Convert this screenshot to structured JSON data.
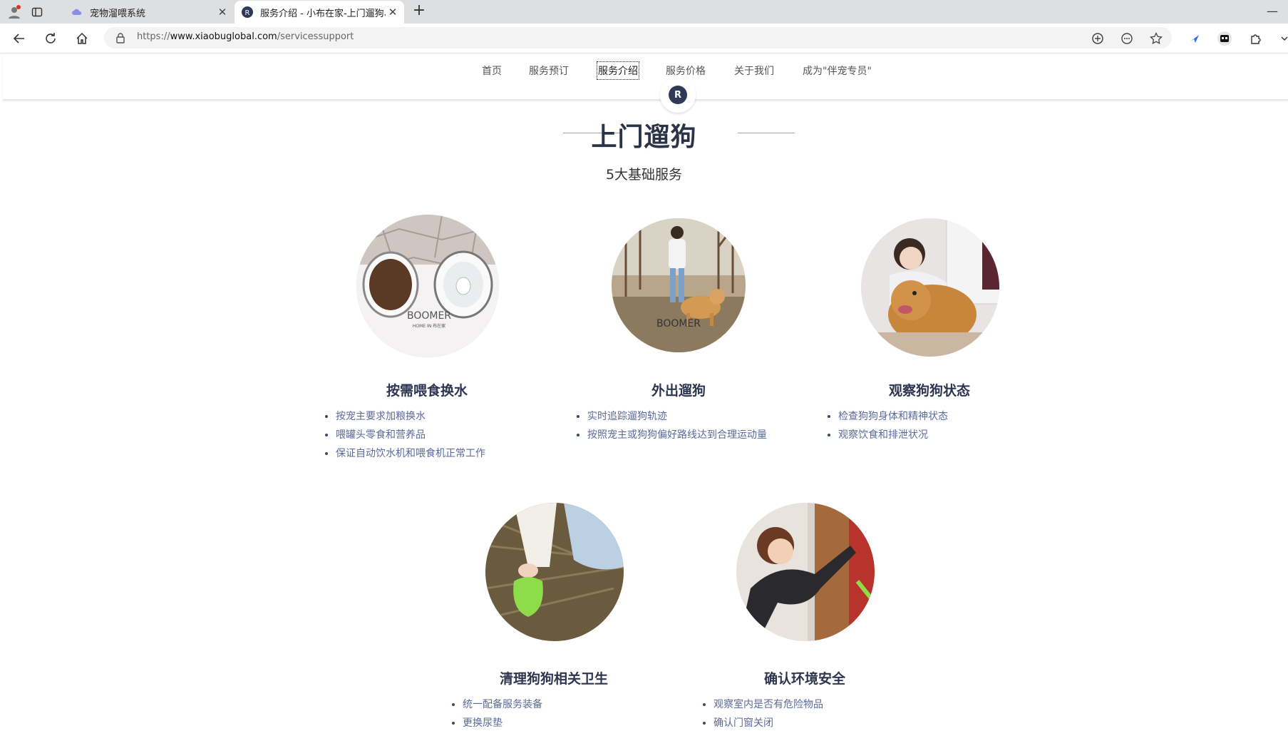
{
  "browser": {
    "tabs": [
      {
        "title": "宠物溜喂系统",
        "active": false
      },
      {
        "title": "服务介绍 - 小布在家-上门遛狗、上",
        "active": true
      }
    ],
    "url_prefix": "https://",
    "url_host": "www.xiaobuglobal.com",
    "url_path": "/servicessupport"
  },
  "site_nav": {
    "items": [
      "首页",
      "服务预订",
      "服务介绍",
      "服务价格",
      "关于我们",
      "成为\"伴宠专员\""
    ],
    "active_index": 2,
    "logo_text": "R"
  },
  "section": {
    "title": "上门遛狗",
    "subtitle": "5大基础服务"
  },
  "services": [
    {
      "title": "按需喂食换水",
      "items": [
        "按宠主要求加粮换水",
        "喂罐头零食和营养品",
        "保证自动饮水机和喂食机正常工作"
      ],
      "photo_text": "BOOMER",
      "photo_caption": "HOME IN 布在家"
    },
    {
      "title": "外出遛狗",
      "items": [
        "实时追踪遛狗轨迹",
        "按照宠主或狗狗偏好路线达到合理运动量"
      ],
      "photo_text": "BOOMER",
      "photo_caption": ""
    },
    {
      "title": "观察狗狗状态",
      "items": [
        "检查狗狗身体和精神状态",
        "观察饮食和排泄状况"
      ],
      "photo_text": "",
      "photo_caption": ""
    },
    {
      "title": "清理狗狗相关卫生",
      "items": [
        "统一配备服务装备",
        "更换尿垫"
      ],
      "photo_text": "",
      "photo_caption": ""
    },
    {
      "title": "确认环境安全",
      "items": [
        "观察室内是否有危险物品",
        "确认门窗关闭"
      ],
      "photo_text": "",
      "photo_caption": ""
    }
  ],
  "colors": {
    "accent": "#2e3550",
    "list_text": "#5b6a9a",
    "logo_bg": "#2d3a5a"
  }
}
